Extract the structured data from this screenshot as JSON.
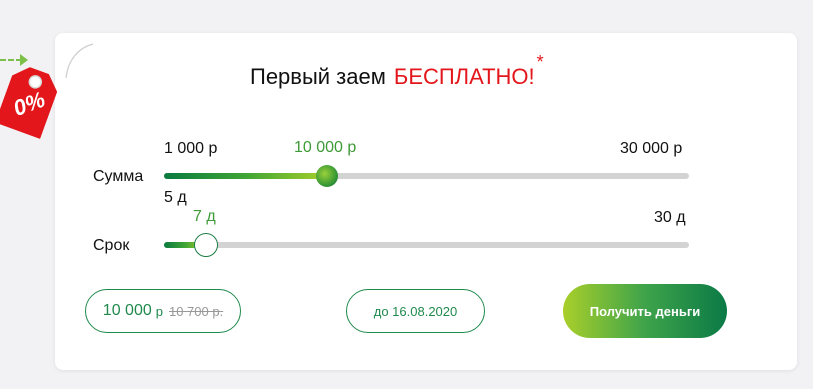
{
  "promo": {
    "tag_label": "0%",
    "colors": {
      "tag": "#e3161b",
      "arrow": "#7cc04a"
    }
  },
  "header": {
    "title_main": "Первый заем",
    "title_accent": "БЕСПЛАТНО!",
    "title_mark": "*"
  },
  "amount": {
    "label": "Сумма",
    "min": "1 000 р",
    "max": "30 000 р",
    "current": "10 000 р",
    "fraction": 0.31
  },
  "term": {
    "label": "Срок",
    "min": "5 д",
    "max": "30 д",
    "current": "7 д",
    "fraction": 0.08
  },
  "summary": {
    "amount": "10 000",
    "amount_unit": "р",
    "old_amount": "10 700 р.",
    "due_date": "до 16.08.2020"
  },
  "cta": {
    "label": "Получить деньги"
  },
  "colors": {
    "accent_red": "#e3161b",
    "brand_green": "#1f8a4c",
    "label_green": "#3f9a38",
    "track": "#d3d3d3"
  }
}
